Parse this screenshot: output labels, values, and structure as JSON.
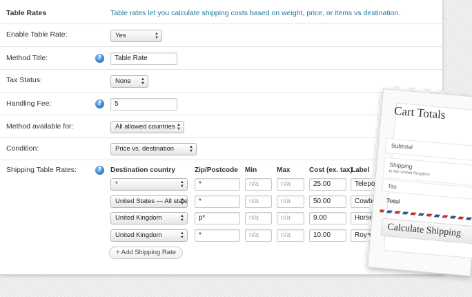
{
  "section": {
    "title": "Table Rates",
    "description": "Table rates let you calculate shipping costs based on weight, price, or items vs destination."
  },
  "fields": {
    "enable": {
      "label": "Enable Table Rate:",
      "value": "Yes"
    },
    "method_title": {
      "label": "Method Title:",
      "value": "Table Rate"
    },
    "tax_status": {
      "label": "Tax Status:",
      "value": "None"
    },
    "handling_fee": {
      "label": "Handling Fee:",
      "value": "5"
    },
    "available_for": {
      "label": "Method available for:",
      "value": "All allowed countries"
    },
    "condition": {
      "label": "Condition:",
      "value": "Price vs. destination"
    }
  },
  "help_glyph": "?",
  "arrows_glyph": "▲▼",
  "shipping_table": {
    "label": "Shipping Table Rates:",
    "columns": [
      "Destination country",
      "Zip/Postcode",
      "Min",
      "Max",
      "Cost (ex. tax)",
      "Label"
    ],
    "rows": [
      {
        "country": "*",
        "zip": "*",
        "min": "n/a",
        "max": "n/a",
        "cost": "25.00",
        "label": "Teleportation"
      },
      {
        "country": "United States — All states",
        "zip": "*",
        "min": "n/a",
        "max": "n/a",
        "cost": "50.00",
        "label": "Cowboy"
      },
      {
        "country": "United Kingdom",
        "zip": "p*",
        "min": "n/a",
        "max": "n/a",
        "cost": "9.00",
        "label": "Horse and Cart"
      },
      {
        "country": "United Kingdom",
        "zip": "*",
        "min": "n/a",
        "max": "n/a",
        "cost": "10.00",
        "label": "Royal Mail"
      }
    ],
    "add_button": "+ Add Shipping Rate"
  },
  "cart": {
    "title": "Cart Totals",
    "subtotal": "Subtotal",
    "shipping": "Shipping",
    "shipping_sub": "to the United Kingdom",
    "tax": "Tax",
    "total": "Total",
    "button": "Calculate Shipping"
  },
  "colors": {
    "link": "#21759b",
    "help_icon": "#2f78c4",
    "airmail_red": "#c0392b",
    "airmail_blue": "#2c5a9c"
  }
}
